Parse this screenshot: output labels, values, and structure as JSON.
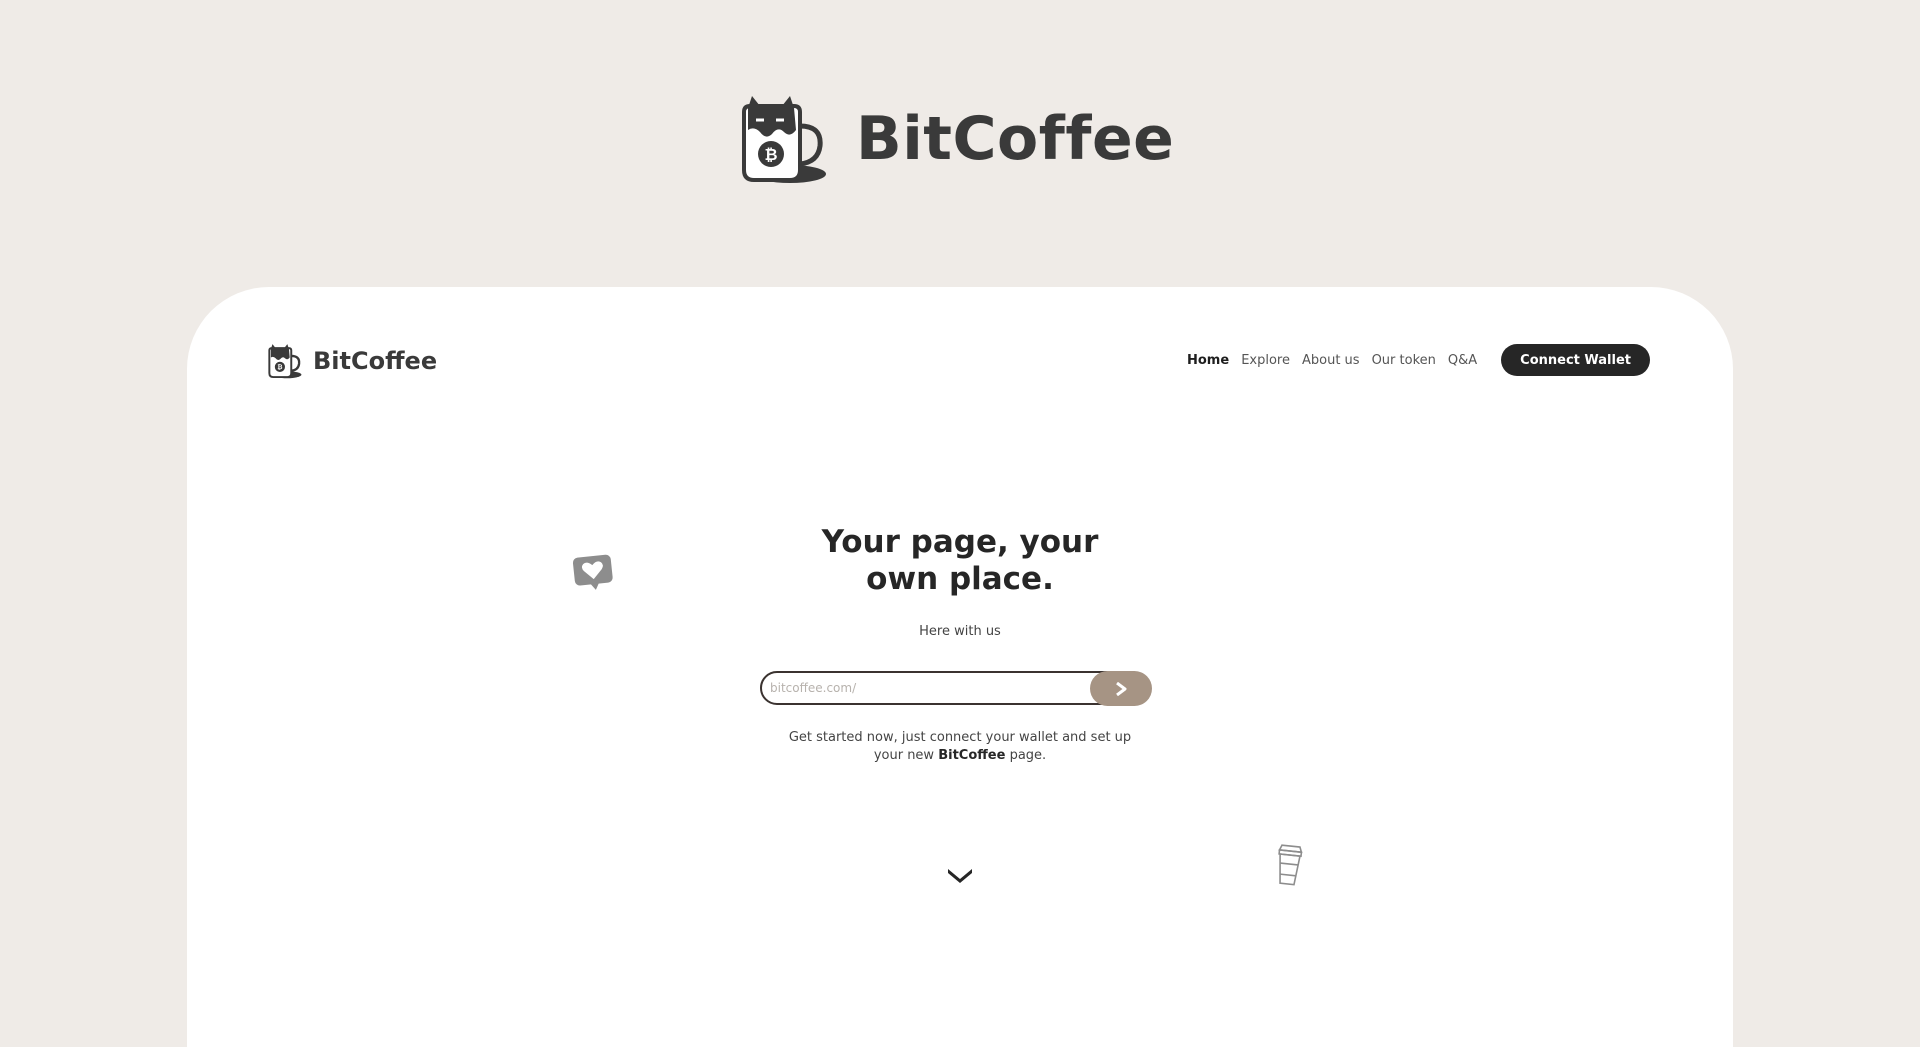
{
  "brand": {
    "name": "BitCoffee"
  },
  "nav": {
    "items": [
      "Home",
      "Explore",
      "About us",
      "Our token",
      "Q&A"
    ],
    "cta": "Connect Wallet"
  },
  "hero": {
    "title_line1": "Your page, your",
    "title_line2": "own place.",
    "subtitle": "Here with us",
    "search_placeholder": "bitcoffee.com/",
    "info_line1": "Get started now, just connect your wallet and set up",
    "info_line2_pre": "your new",
    "info_line2_brand": "BitCoffee",
    "info_line2_post": "page."
  },
  "colors": {
    "page_bg": "#efebe7",
    "card_bg": "#ffffff",
    "button_dark": "#262626",
    "accent": "#a69484"
  },
  "icons": [
    "coffee-mug-cat-logo-icon",
    "heart-bubble-icon",
    "takeaway-cup-icon",
    "chevron-down-icon",
    "chevron-right-icon"
  ]
}
